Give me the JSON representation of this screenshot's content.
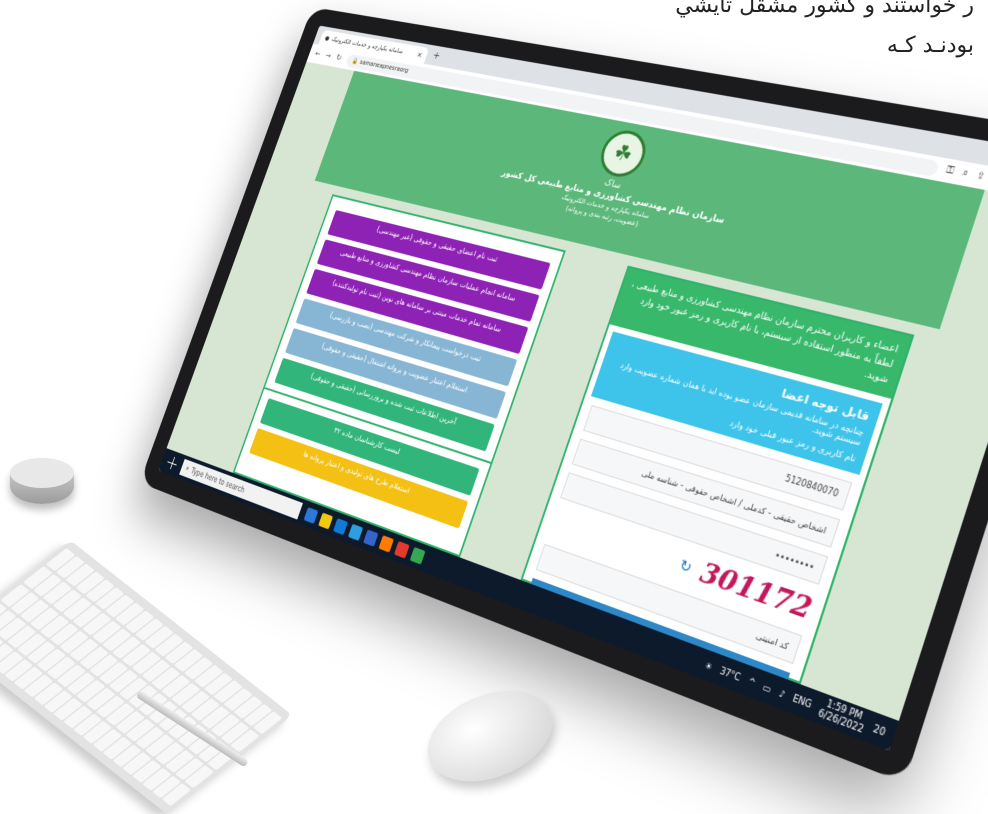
{
  "caption": {
    "line1": "ر خواستند و كشور مشقل تايشي",
    "line2": "بودنـد کـه"
  },
  "browser": {
    "tab_title": "سامانه یکپارچه و خدمات الکترونیک",
    "url": "samaneapnesraorg",
    "window_controls": [
      "—",
      "□",
      "✕"
    ]
  },
  "header": {
    "org_short": "ساک",
    "org_name": "سازمان نظام مهندسی کشاورزی و منابع طبیعی کل کشور",
    "system_name": "سامانه یکپارچه و خدمات الکترونیک",
    "subtitle": "(عضویت، رتبه بندی و پروانه)"
  },
  "right_panel": {
    "notice": "اعضاء و کاربران محترم سازمان نظام مهندسی کشاورزی و منابع طبیعی ، لطفاً به منظور استفاده از سیستم، با نام کاربری و رمز عبور خود وارد شوید.",
    "alert_title": "قابل توجه اعضا",
    "alert_text": "چنانچه در سامانه قدیمی سازمان عضو بوده اید با همان شماره عضویت وارد سیستم شوید.",
    "alert_hint": "نام کاربری و رمز عبور قبلی خود وارد",
    "username_value": "5120840070",
    "type_placeholder": "اشخاص حقیقی - کدملی / اشخاص حقوقی - شناسه ملی",
    "password_mask": "••••••••",
    "captcha": "301172",
    "captcha_placeholder": "کد امنیتی"
  },
  "left_panel": {
    "buttons": [
      "ثبت نام اعضای حقیقی و حقوقی (غیر مهندسی)",
      "سامانه انجام عملیات سازمان نظام مهندسی کشاورزی و منابع طبیعی",
      "سامانه تمام خدمات مبتنی بر سامانه های نوین (ثبت نام تولیدکننده)",
      "ثبت درخواست پیمانکار و شرکت مهندسی (نصب و بازرسی)",
      "استعلام اعتبار عضویت و پروانه اشتغال (حقیقی و حقوقی)",
      "آخرین اطلاعات ثبت شده و بروزرسانی (حقیقی و حقوقی)"
    ],
    "bottom_buttons": [
      "لیست کارشناسان ماده ۳۲",
      "استعلام طرح های تولیدی و اعتبار پروانه ها"
    ]
  },
  "taskbar": {
    "search_placeholder": "Type here to search",
    "weather": "37°C",
    "language": "ENG",
    "time": "1:59 PM",
    "date": "6/26/2022",
    "notifications": "20"
  },
  "colors": {
    "header_green": "#5cb87a",
    "purple": "#8d22b5",
    "light_blue": "#87b6d4",
    "green": "#31b57a",
    "yellow": "#f3c013",
    "captcha_magenta": "#c2185b",
    "alert_cyan": "#3ec4ea"
  }
}
